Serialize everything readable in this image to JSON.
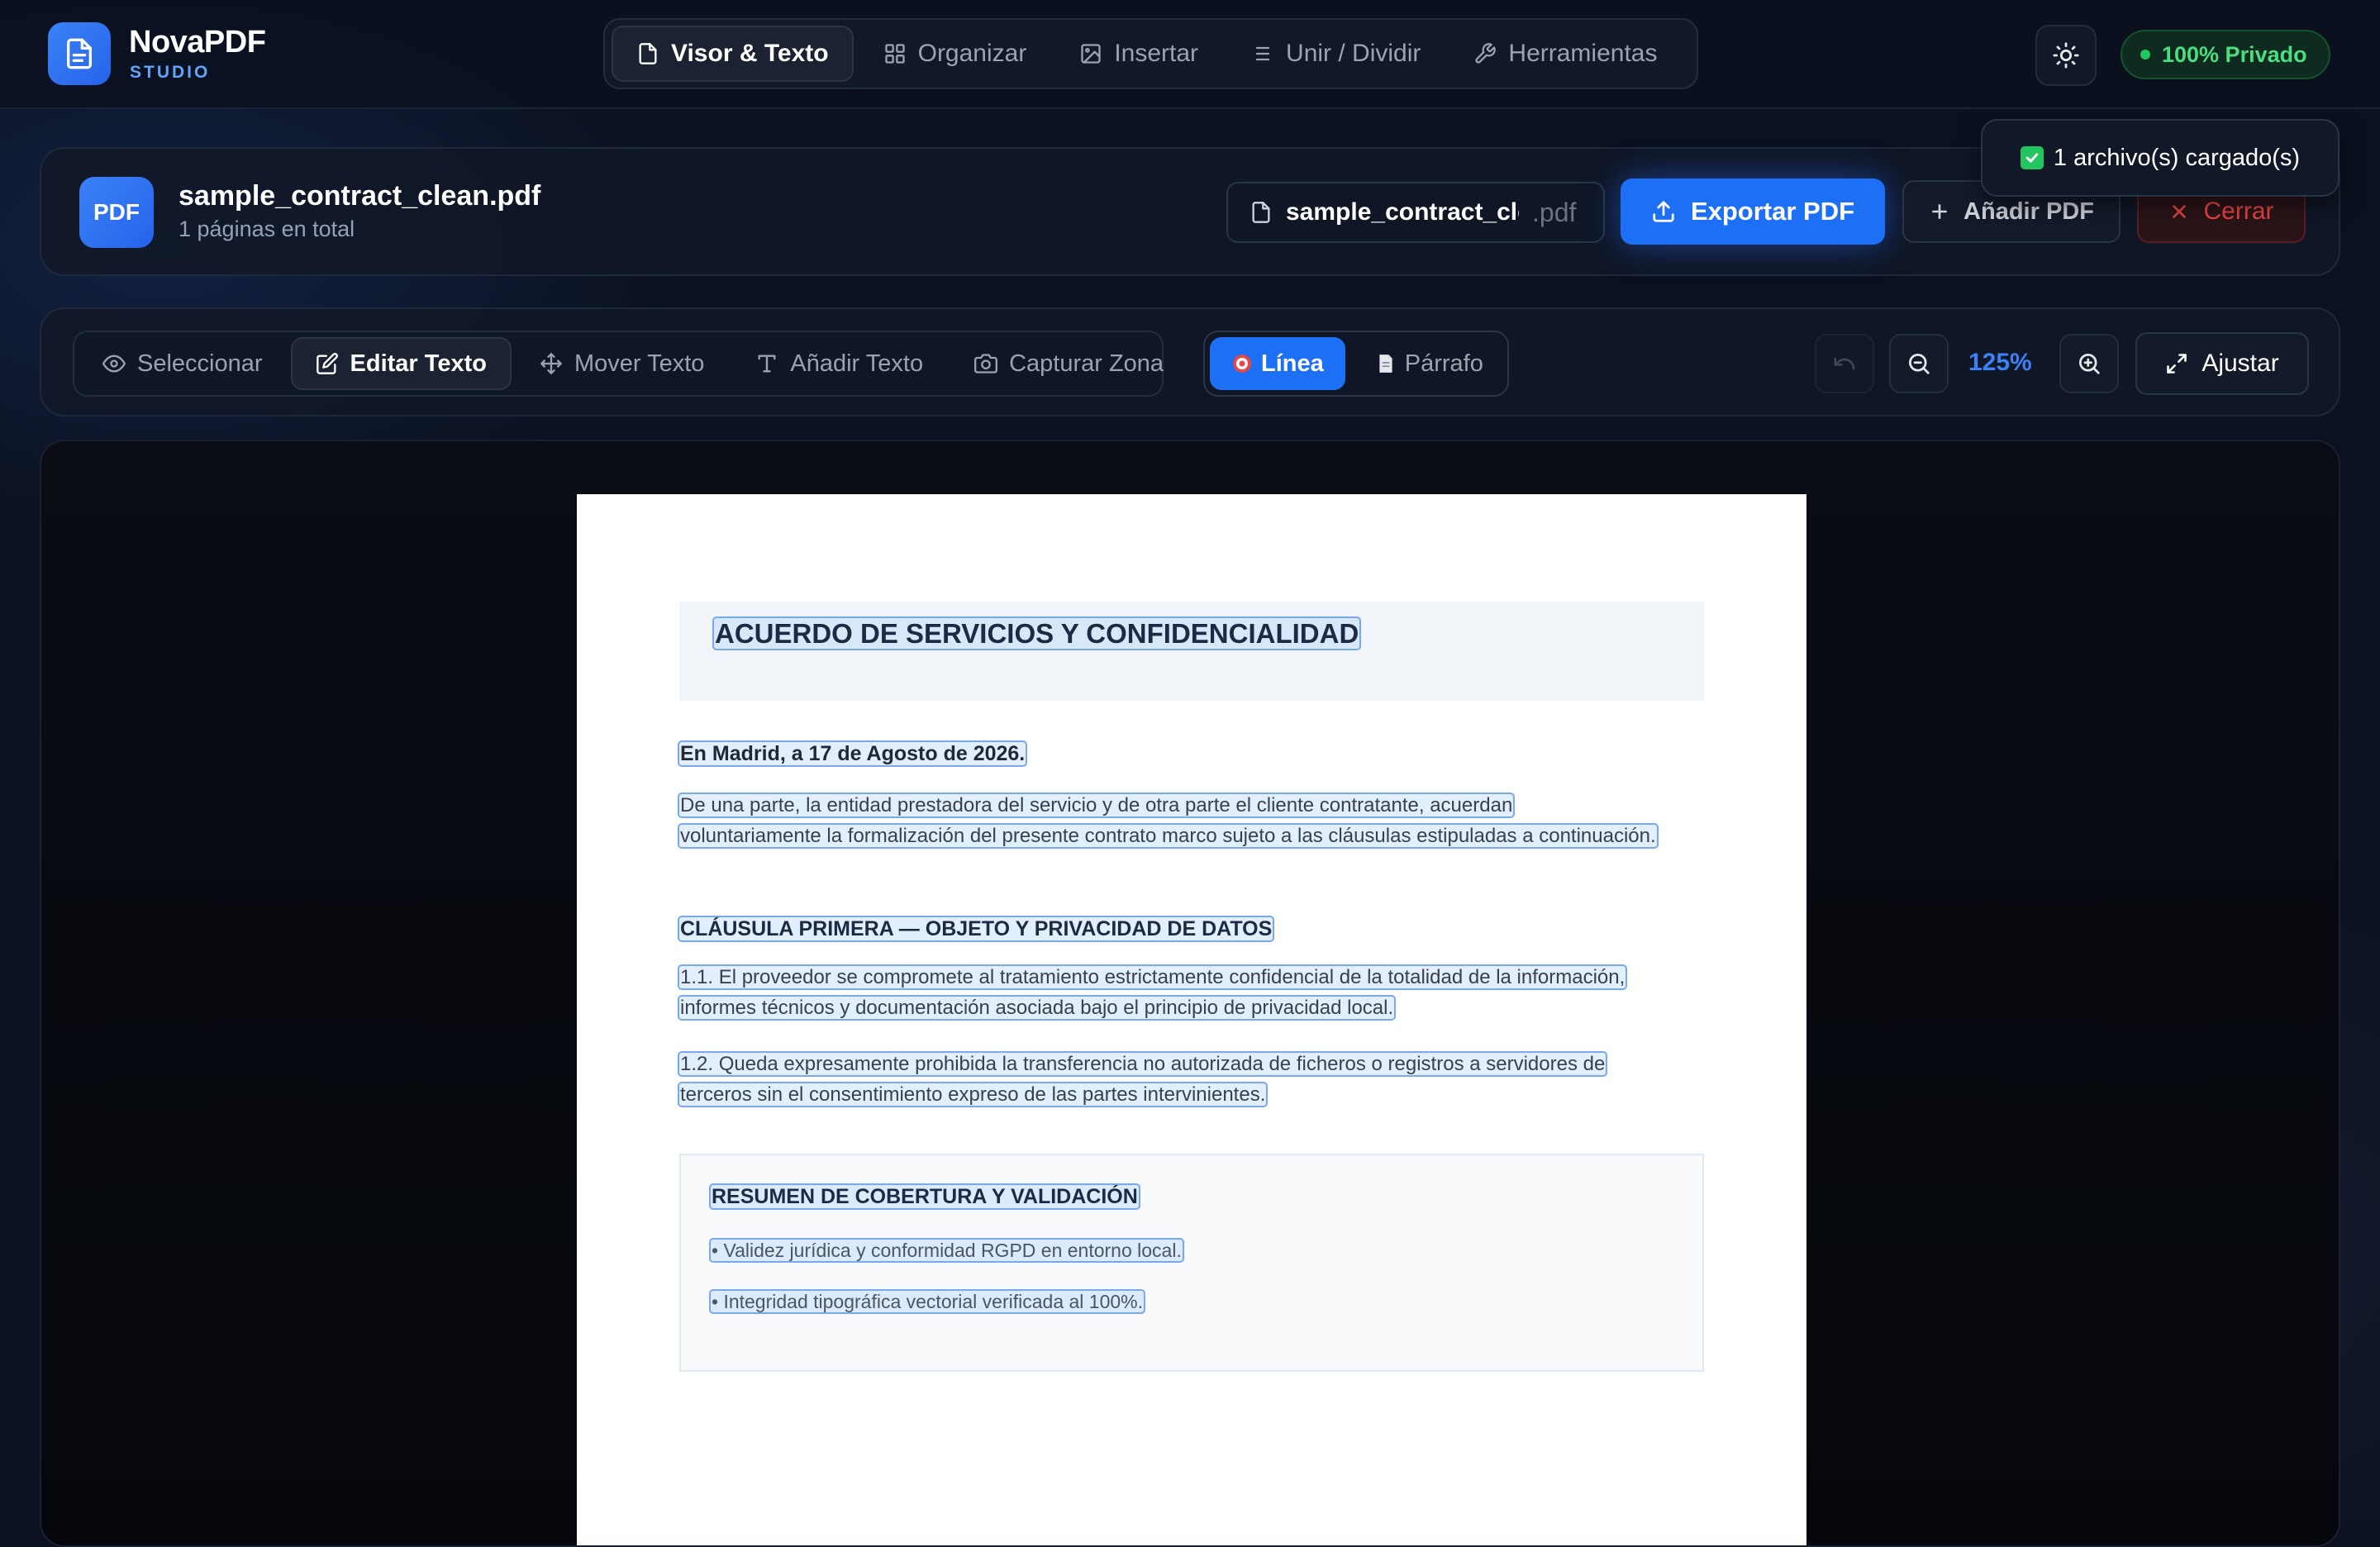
{
  "app": {
    "name": "NovaPDF",
    "subtitle": "STUDIO"
  },
  "nav": {
    "tabs": [
      {
        "label": "Visor & Texto",
        "icon": "file-icon",
        "active": true
      },
      {
        "label": "Organizar",
        "icon": "grid-icon",
        "active": false
      },
      {
        "label": "Insertar",
        "icon": "image-icon",
        "active": false
      },
      {
        "label": "Unir / Dividir",
        "icon": "list-icon",
        "active": false
      },
      {
        "label": "Herramientas",
        "icon": "wrench-icon",
        "active": false
      }
    ],
    "theme_icon": "sun-icon",
    "privacy_badge": "100% Privado"
  },
  "file": {
    "badge": "PDF",
    "name": "sample_contract_clean.pdf",
    "pages": "1 páginas en total",
    "rename_value": "sample_contract_clean",
    "extension": ".pdf",
    "export_label": "Exportar PDF",
    "add_label": "Añadir PDF",
    "close_label": "Cerrar"
  },
  "toast": {
    "message": "1 archivo(s) cargado(s)"
  },
  "toolbar": {
    "tools": [
      {
        "label": "Seleccionar",
        "icon": "eye-icon",
        "active": false
      },
      {
        "label": "Editar Texto",
        "icon": "edit-icon",
        "active": true
      },
      {
        "label": "Mover Texto",
        "icon": "move-icon",
        "active": false
      },
      {
        "label": "Añadir Texto",
        "icon": "type-icon",
        "active": false
      },
      {
        "label": "Capturar Zona",
        "icon": "camera-icon",
        "active": false
      }
    ],
    "modes": [
      {
        "label": "Línea",
        "icon": "target-icon",
        "active": true
      },
      {
        "label": "Párrafo",
        "icon": "page-icon",
        "active": false
      }
    ],
    "zoom": "125%",
    "fit_label": "Ajustar"
  },
  "document": {
    "title": "ACUERDO DE SERVICIOS Y CONFIDENCIALIDAD",
    "date": "En Madrid, a 17 de Agosto de 2026.",
    "intro_line1": "De una parte, la entidad prestadora del servicio y de otra parte el cliente contratante, acuerdan",
    "intro_line2": "voluntariamente la formalización del presente contrato marco sujeto a las cláusulas estipuladas a continuación.",
    "clause_title": "CLÁUSULA PRIMERA — OBJETO Y PRIVACIDAD DE DATOS",
    "clause_1_1_line1": "1.1. El proveedor se compromete al tratamiento estrictamente confidencial de la totalidad de la información,",
    "clause_1_1_line2": "informes técnicos y documentación asociada bajo el principio de privacidad local.",
    "clause_1_2_line1": "1.2. Queda expresamente prohibida la transferencia no autorizada de ficheros o registros a servidores de",
    "clause_1_2_line2": "terceros sin el consentimiento expreso de las partes intervinientes.",
    "summary_title": "RESUMEN DE COBERTURA Y VALIDACIÓN",
    "summary_items": [
      "• Validez jurídica y conformidad RGPD en entorno local.",
      "• Integridad tipográfica vectorial verificada al 100%."
    ]
  },
  "colors": {
    "accent": "#1d6ff5",
    "success": "#22c55e",
    "danger": "#ef4444",
    "background": "#0b1120"
  }
}
